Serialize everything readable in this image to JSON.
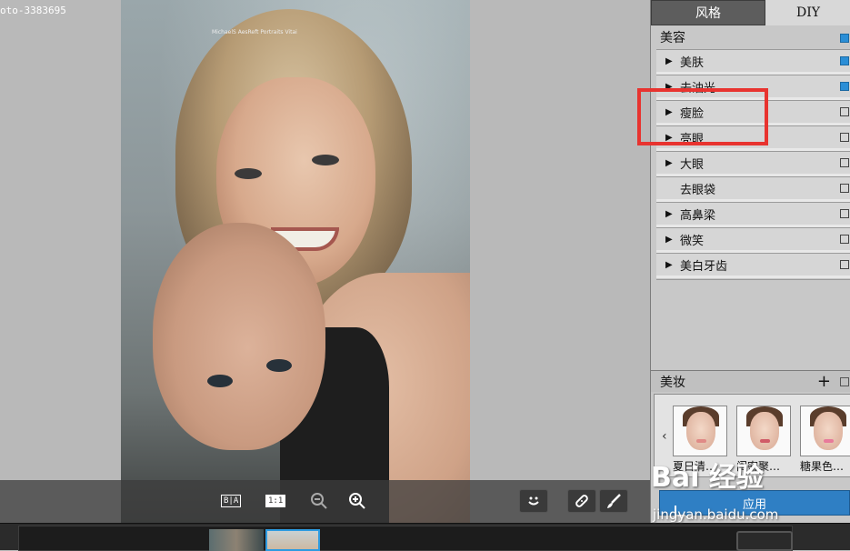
{
  "file_label": "oto-3383695",
  "photo": {
    "watermark_text": "MichaelS AesReft Portraits Vitai"
  },
  "toolbar": {
    "before_after_label": "B|A",
    "actual_size_label": "1:1",
    "zoom_out": "zoom-out",
    "zoom_in": "zoom-in"
  },
  "panel": {
    "tabs": [
      {
        "label": "风格",
        "active": false
      },
      {
        "label": "DIY",
        "active": true
      }
    ],
    "beauty": {
      "title": "美容",
      "enabled": true,
      "items": [
        {
          "label": "美肤",
          "has_arrow": true,
          "checked": true
        },
        {
          "label": "去油光",
          "has_arrow": true,
          "checked": true
        },
        {
          "label": "瘦脸",
          "has_arrow": true,
          "checked": false
        },
        {
          "label": "亮眼",
          "has_arrow": true,
          "checked": false
        },
        {
          "label": "大眼",
          "has_arrow": true,
          "checked": false
        },
        {
          "label": "去眼袋",
          "has_arrow": false,
          "checked": false
        },
        {
          "label": "高鼻梁",
          "has_arrow": true,
          "checked": false
        },
        {
          "label": "微笑",
          "has_arrow": true,
          "checked": false
        },
        {
          "label": "美白牙齿",
          "has_arrow": true,
          "checked": false
        }
      ]
    },
    "makeup": {
      "title": "美妆",
      "add": "+",
      "prev": "‹",
      "cards": [
        {
          "label": "夏日清…",
          "lip": "#e08a86"
        },
        {
          "label": "闺密聚…",
          "lip": "#d05b67"
        },
        {
          "label": "糖果色…",
          "lip": "#e87a9b"
        }
      ]
    },
    "apply_label": "应用"
  },
  "overlay": {
    "baidu": "Bai 经验",
    "baidu_url": "jingyan.baidu.com"
  },
  "colors": {
    "accent": "#2f7fc4",
    "checkbox_on": "#2a8ed6",
    "highlight": "#e8332f"
  }
}
